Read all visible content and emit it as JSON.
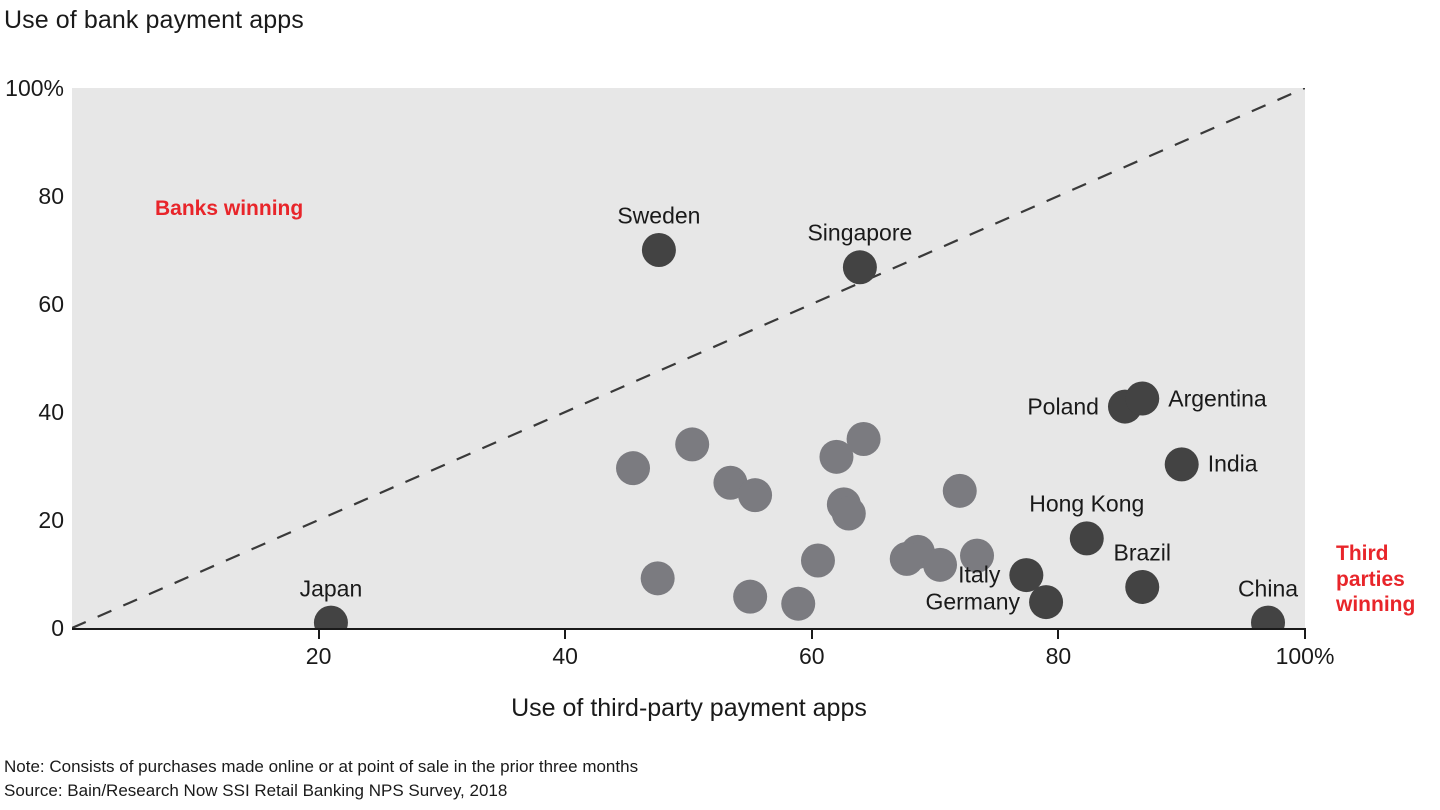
{
  "chart_data": {
    "type": "scatter",
    "title": "Use of bank payment apps",
    "xlabel": "Use of third-party payment apps",
    "ylabel": "Use of bank payment apps",
    "xlim": [
      0,
      100
    ],
    "ylim": [
      0,
      100
    ],
    "x_ticks": [
      {
        "value": 20,
        "label": "20"
      },
      {
        "value": 40,
        "label": "40"
      },
      {
        "value": 60,
        "label": "60"
      },
      {
        "value": 80,
        "label": "80"
      },
      {
        "value": 100,
        "label": "100%"
      }
    ],
    "y_ticks": [
      {
        "value": 0,
        "label": "0"
      },
      {
        "value": 20,
        "label": "20"
      },
      {
        "value": 40,
        "label": "40"
      },
      {
        "value": 60,
        "label": "60"
      },
      {
        "value": 80,
        "label": "80"
      },
      {
        "value": 100,
        "label": "100%"
      }
    ],
    "grid": false,
    "legend": "none",
    "reference_line": {
      "type": "dashed-diagonal",
      "from": [
        0,
        0
      ],
      "to": [
        100,
        100
      ],
      "color": "#3a3a3a"
    },
    "annotations": [
      {
        "id": "banks-winning",
        "text": "Banks winning",
        "color": "#e8252a",
        "position": "top-left"
      },
      {
        "id": "third-parties-winning",
        "text": "Third parties winning",
        "color": "#e8252a",
        "position": "right-outside"
      }
    ],
    "colors": {
      "highlighted_point": "#434343",
      "other_point": "#7b7b80",
      "plot_background": "#e7e7e7",
      "accent_red": "#e8252a",
      "text": "#1a1a1a"
    },
    "points": [
      {
        "label": "Japan",
        "x": 21.0,
        "y": 1.0,
        "highlight": true,
        "label_dx": 0,
        "label_dy": -34,
        "anchor": "mid"
      },
      {
        "label": "Sweden",
        "x": 47.6,
        "y": 70.0,
        "highlight": true,
        "label_dx": 0,
        "label_dy": -34,
        "anchor": "mid"
      },
      {
        "label": "Singapore",
        "x": 63.9,
        "y": 66.8,
        "highlight": true,
        "label_dx": 0,
        "label_dy": -34,
        "anchor": "mid"
      },
      {
        "label": "Poland",
        "x": 85.4,
        "y": 41.0,
        "highlight": true,
        "label_dx": -26,
        "label_dy": 0,
        "anchor": "end"
      },
      {
        "label": "Argentina",
        "x": 86.8,
        "y": 42.5,
        "highlight": true,
        "label_dx": 26,
        "label_dy": 0,
        "anchor": "start"
      },
      {
        "label": "India",
        "x": 90.0,
        "y": 30.3,
        "highlight": true,
        "label_dx": 26,
        "label_dy": 0,
        "anchor": "start"
      },
      {
        "label": "Hong Kong",
        "x": 82.3,
        "y": 16.6,
        "highlight": true,
        "label_dx": 0,
        "label_dy": -34,
        "anchor": "mid"
      },
      {
        "label": "Brazil",
        "x": 86.8,
        "y": 7.6,
        "highlight": true,
        "label_dx": 0,
        "label_dy": -34,
        "anchor": "mid"
      },
      {
        "label": "Italy",
        "x": 77.4,
        "y": 9.8,
        "highlight": true,
        "label_dx": -26,
        "label_dy": 0,
        "anchor": "end"
      },
      {
        "label": "Germany",
        "x": 79.0,
        "y": 4.8,
        "highlight": true,
        "label_dx": -26,
        "label_dy": 0,
        "anchor": "end"
      },
      {
        "label": "China",
        "x": 97.0,
        "y": 1.0,
        "highlight": true,
        "label_dx": 0,
        "label_dy": -34,
        "anchor": "mid"
      },
      {
        "label": "",
        "x": 45.5,
        "y": 29.6,
        "highlight": false
      },
      {
        "label": "",
        "x": 50.3,
        "y": 34.0,
        "highlight": false
      },
      {
        "label": "",
        "x": 53.4,
        "y": 26.9,
        "highlight": false
      },
      {
        "label": "",
        "x": 55.4,
        "y": 24.6,
        "highlight": false
      },
      {
        "label": "",
        "x": 62.0,
        "y": 31.7,
        "highlight": false
      },
      {
        "label": "",
        "x": 64.2,
        "y": 35.0,
        "highlight": false
      },
      {
        "label": "",
        "x": 62.6,
        "y": 22.9,
        "highlight": false
      },
      {
        "label": "",
        "x": 63.0,
        "y": 21.2,
        "highlight": false
      },
      {
        "label": "",
        "x": 72.0,
        "y": 25.4,
        "highlight": false
      },
      {
        "label": "",
        "x": 47.5,
        "y": 9.2,
        "highlight": false
      },
      {
        "label": "",
        "x": 55.0,
        "y": 5.8,
        "highlight": false
      },
      {
        "label": "",
        "x": 58.9,
        "y": 4.5,
        "highlight": false
      },
      {
        "label": "",
        "x": 60.5,
        "y": 12.5,
        "highlight": false
      },
      {
        "label": "",
        "x": 68.6,
        "y": 14.1,
        "highlight": false
      },
      {
        "label": "",
        "x": 67.7,
        "y": 12.8,
        "highlight": false
      },
      {
        "label": "",
        "x": 70.4,
        "y": 11.7,
        "highlight": false
      },
      {
        "label": "",
        "x": 73.4,
        "y": 13.4,
        "highlight": false
      }
    ]
  },
  "footnotes": {
    "note": "Note: Consists of purchases made online or at point of sale in the prior three months",
    "source": "Source: Bain/Research Now SSI Retail Banking NPS Survey, 2018"
  }
}
